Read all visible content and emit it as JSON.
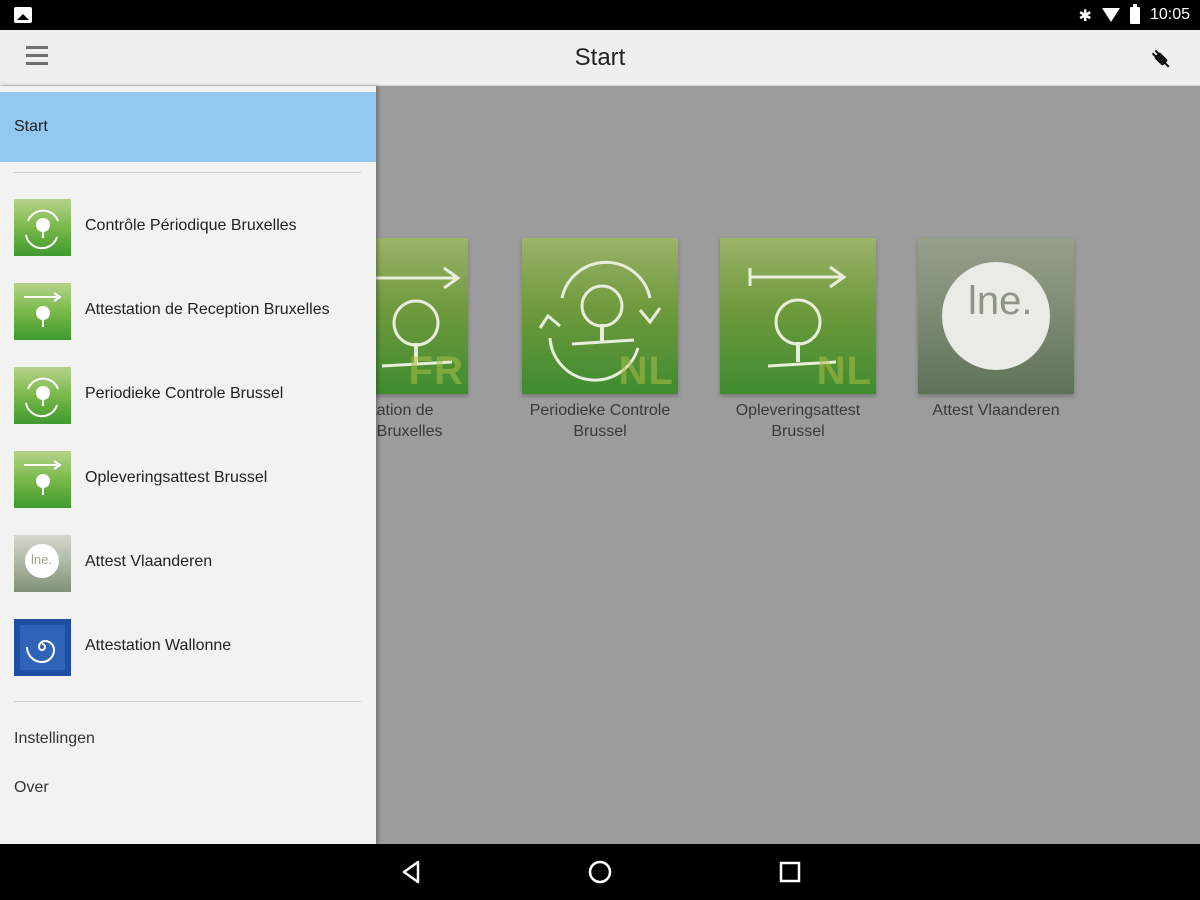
{
  "status_bar": {
    "time": "10:05",
    "icons": [
      "gallery-icon",
      "bluetooth-icon",
      "wifi-icon",
      "battery-icon"
    ]
  },
  "app_bar": {
    "title": "Start",
    "menu_icon": "hamburger-menu-icon",
    "action_icon": "plug-icon"
  },
  "drawer": {
    "selected": {
      "label": "Start"
    },
    "items": [
      {
        "label": "Contrôle Périodique Bruxelles",
        "icon": "cycle-tree-icon"
      },
      {
        "label": "Attestation de Reception Bruxelles",
        "icon": "arrow-tree-icon"
      },
      {
        "label": "Periodieke Controle Brussel",
        "icon": "cycle-tree-icon"
      },
      {
        "label": "Opleveringsattest Brussel",
        "icon": "arrow-tree-icon"
      },
      {
        "label": "Attest Vlaanderen",
        "icon": "lne-logo-icon"
      },
      {
        "label": "Attestation Wallonne",
        "icon": "spiral-logo-icon"
      }
    ],
    "links": [
      {
        "label": "Instellingen"
      },
      {
        "label": "Over"
      }
    ]
  },
  "tiles": [
    {
      "label_line1": "ttestation de",
      "label_line2": "ption Bruxelles",
      "tag": "FR"
    },
    {
      "label_line1": "Periodieke Controle",
      "label_line2": "Brussel",
      "tag": "NL"
    },
    {
      "label_line1": "Opleveringsattest",
      "label_line2": "Brussel",
      "tag": "NL"
    },
    {
      "label_line1": "Attest Vlaanderen",
      "label_line2": "",
      "tag": ""
    }
  ],
  "tile_logo_text": "lne.",
  "nav_bar": {
    "icons": [
      "back-icon",
      "home-icon",
      "recents-icon"
    ]
  },
  "colors": {
    "selected_bg": "#93c9f0",
    "drawer_bg": "#f2f2f2",
    "scrim": "#9c9c9c",
    "appbar": "#efefef"
  }
}
